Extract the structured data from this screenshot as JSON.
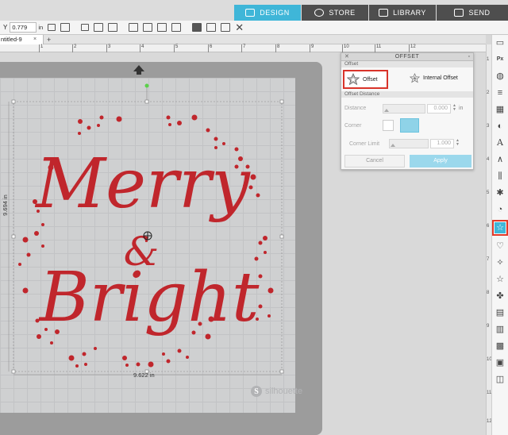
{
  "nav": {
    "tabs": [
      {
        "label": "DESIGN",
        "icon": "grid-icon",
        "active": true
      },
      {
        "label": "STORE",
        "icon": "silhouette-s-icon",
        "active": false
      },
      {
        "label": "LIBRARY",
        "icon": "download-icon",
        "active": false
      },
      {
        "label": "SEND",
        "icon": "cutter-icon",
        "active": false
      }
    ],
    "accent": "#3fb6d8"
  },
  "toolbar": {
    "y_label": "Y",
    "y_value": "0.779",
    "y_unit": "in"
  },
  "document": {
    "tab_label": "ntitled-9",
    "close": "×",
    "add": "+"
  },
  "ruler": {
    "top_ticks": [
      "1",
      "2",
      "3",
      "4",
      "5",
      "6",
      "7",
      "8",
      "9",
      "10",
      "11",
      "12"
    ],
    "right_ticks": [
      "1",
      "2",
      "3",
      "4",
      "5",
      "6",
      "7",
      "8",
      "9",
      "10",
      "11",
      "12"
    ]
  },
  "canvas": {
    "design_text_1": "Merry",
    "design_text_2": "&",
    "design_text_3": "Bright",
    "width_dim": "9.622 in",
    "height_dim": "9.694 in",
    "watermark": "silhouette",
    "design_color": "#c0262c"
  },
  "offset_panel": {
    "title": "OFFSET",
    "section_offset": "Offset",
    "offset_label": "Offset",
    "internal_offset_label": "Internal Offset",
    "section_distance": "Offset Distance",
    "distance_label": "Distance",
    "distance_value": "0.000",
    "distance_unit": "in",
    "corner_label": "Corner",
    "corner_limit_label": "Corner Limit",
    "corner_limit_value": "1.000",
    "cancel_label": "Cancel",
    "apply_label": "Apply",
    "highlight_color": "#d9342a"
  },
  "rightbar": {
    "icons": [
      "page-setup-icon",
      "pixscan-icon",
      "fill-color-icon",
      "line-style-icon",
      "fill-pattern-icon",
      "transparency-icon",
      "text-style-icon",
      "align-icon",
      "transform-icon",
      "replicate-icon",
      "modify-icon",
      "offset-icon",
      "trace-icon",
      "sketch-icon",
      "rhinestone-icon",
      "puzzle-icon",
      "layers-icon",
      "library-icon",
      "grid-icon",
      "shop-icon",
      "emboss-icon"
    ],
    "active_icon": "offset-icon"
  }
}
